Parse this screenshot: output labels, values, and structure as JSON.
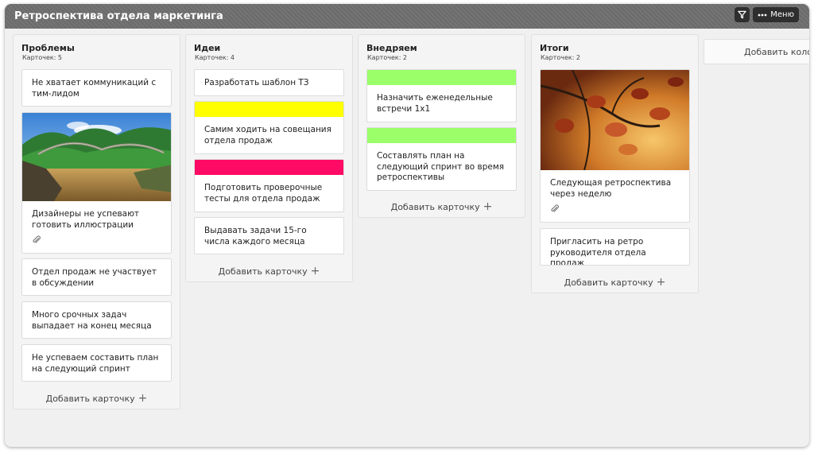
{
  "board": {
    "title": "Ретроспектива отдела маркетинга",
    "menu_label": "Меню"
  },
  "colors": {
    "yellow": "#ffff00",
    "pink": "#ff0a64",
    "green": "#9bff6a"
  },
  "columns": [
    {
      "title": "Проблемы",
      "count": "Карточек: 5",
      "cards": [
        {
          "text": "Не хватает коммуникаций с тим-лидом"
        },
        {
          "text": "Дизайнеры не успевают готовить иллюстрации",
          "image": "mountain-bridge",
          "attachment": true
        },
        {
          "text": "Отдел продаж не участвует в обсуждении"
        },
        {
          "text": "Много срочных задач выпадает на конец месяца"
        },
        {
          "text": "Не успеваем составить план на следующий спринт"
        }
      ],
      "add_label": "Добавить карточку"
    },
    {
      "title": "Идеи",
      "count": "Карточек: 4",
      "cards": [
        {
          "text": "Разработать шаблон ТЗ"
        },
        {
          "text": "Самим ходить на совещания отдела продаж",
          "label_color": "yellow"
        },
        {
          "text": "Подготовить проверочные тесты для отдела продаж",
          "label_color": "pink"
        },
        {
          "text": "Выдавать задачи 15-го числа каждого месяца"
        }
      ],
      "add_label": "Добавить карточку"
    },
    {
      "title": "Внедряем",
      "count": "Карточек: 2",
      "cards": [
        {
          "text": "Назначить еженедельные встречи 1х1",
          "label_color": "green"
        },
        {
          "text": "Составлять план на следующий спринт во время ретроспективы",
          "label_color": "green"
        }
      ],
      "add_label": "Добавить карточку"
    },
    {
      "title": "Итоги",
      "count": "Карточек: 2",
      "cards": [
        {
          "text": "Следующая ретроспектива через неделю",
          "image": "autumn-leaves",
          "attachment": true
        },
        {
          "text": "Пригласить на ретро руководителя отдела продаж"
        }
      ],
      "add_label": "Добавить карточку"
    }
  ],
  "add_column_label": "Добавить колонку"
}
